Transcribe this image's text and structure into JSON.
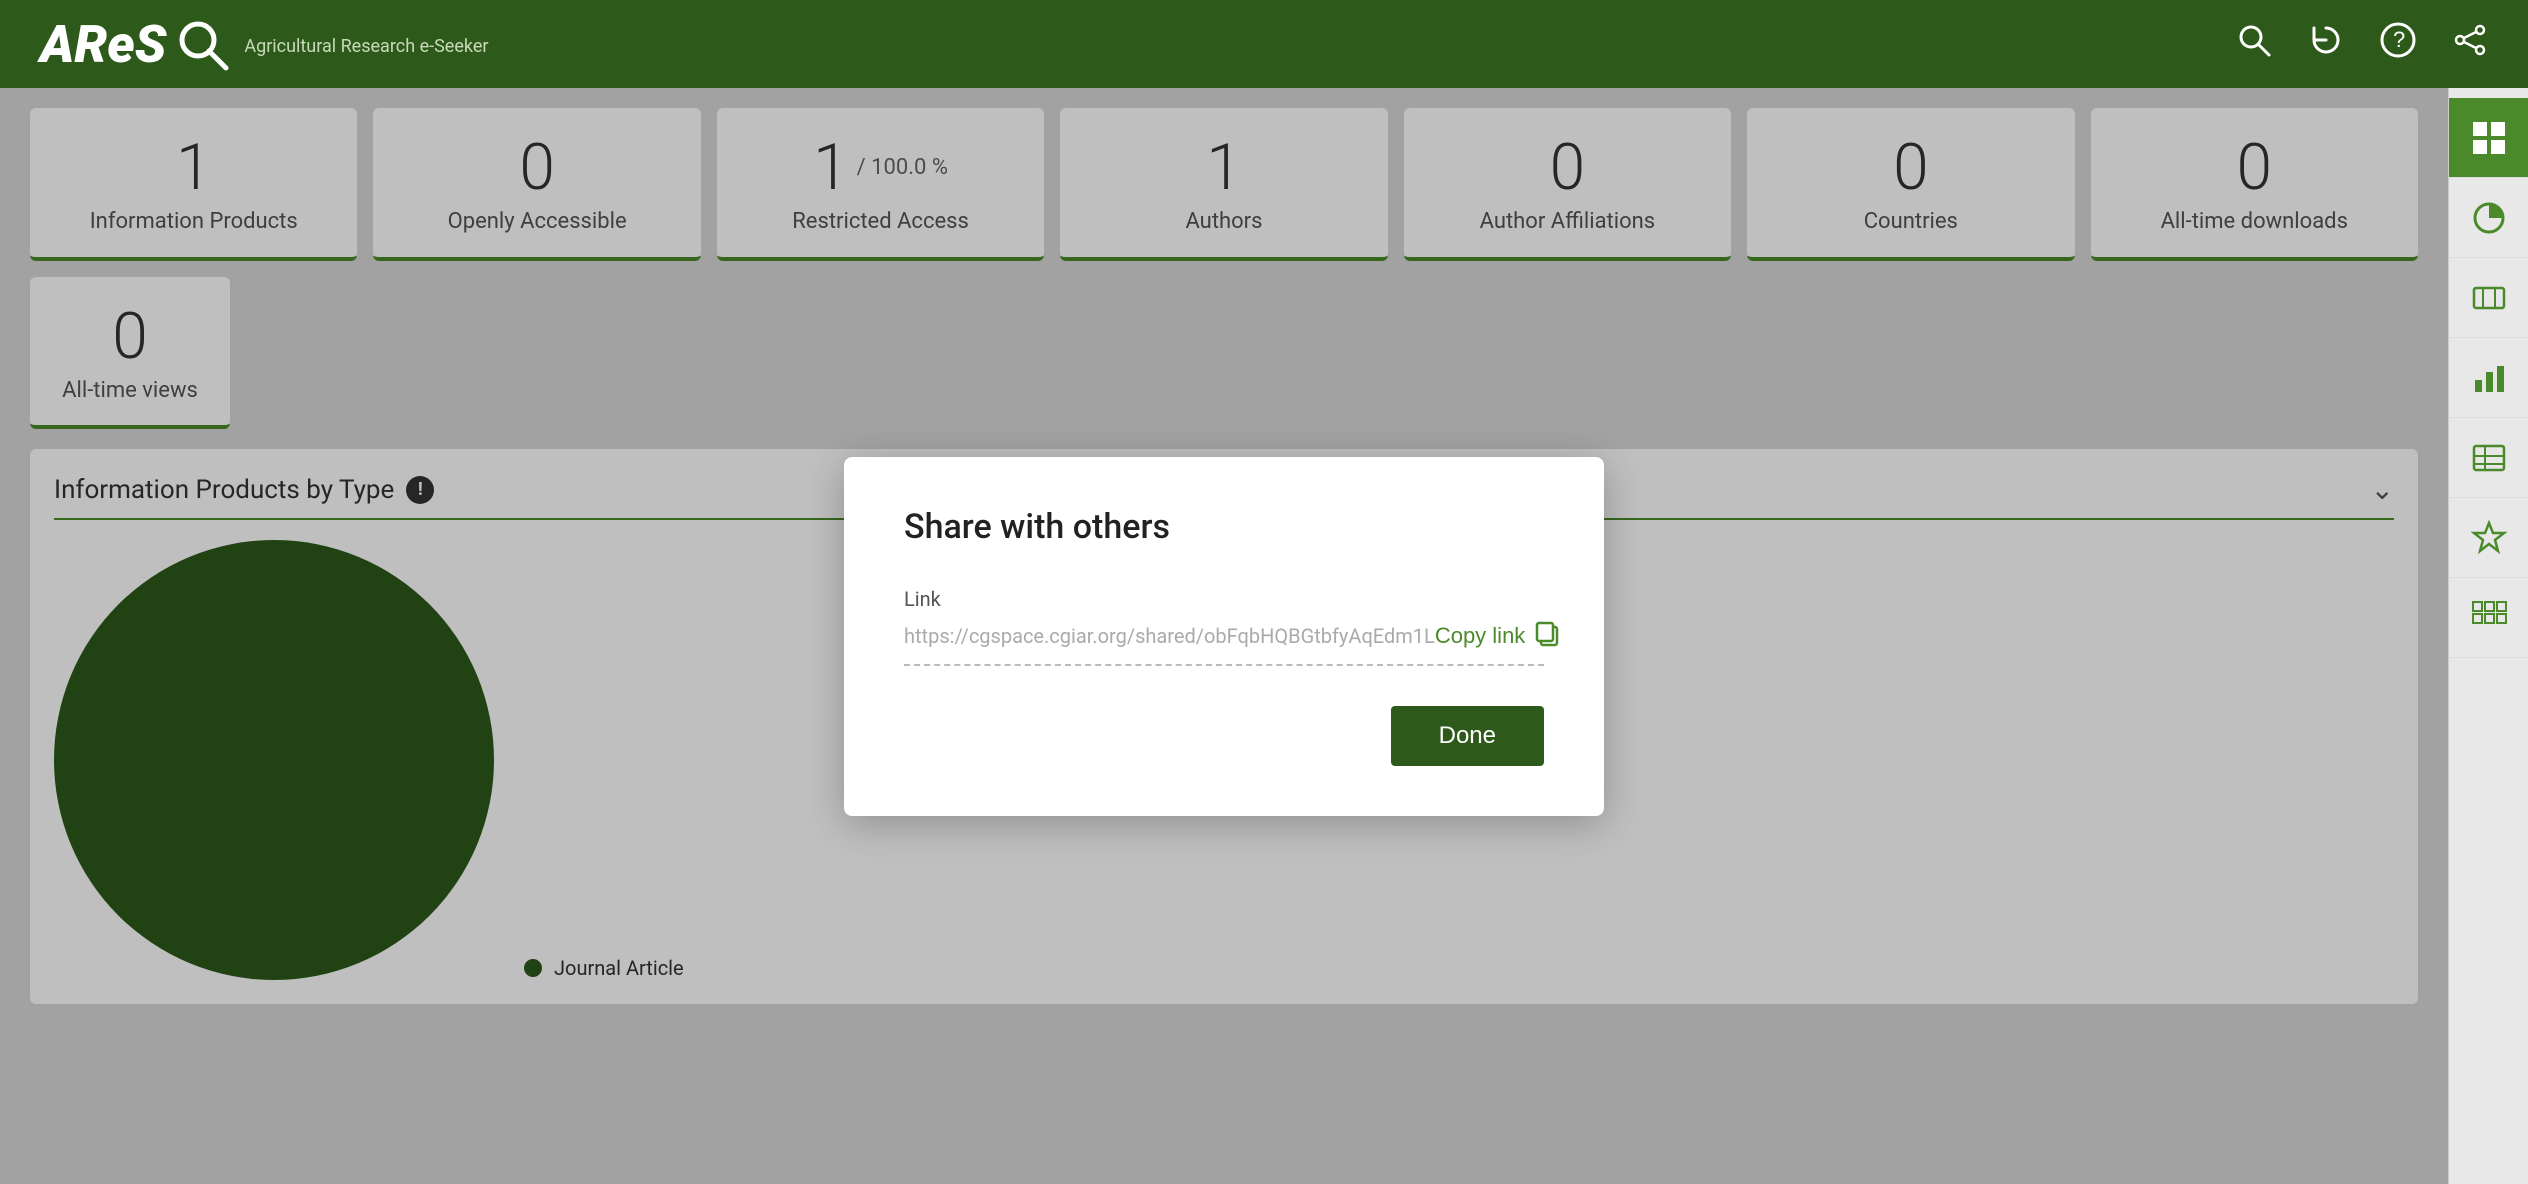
{
  "header": {
    "app_name": "AReS",
    "app_subtitle": "Agricultural Research e-Seeker",
    "icons": [
      "search",
      "refresh",
      "help",
      "share"
    ]
  },
  "stats": {
    "row1": [
      {
        "number": "1",
        "label": "Information Products",
        "suffix": ""
      },
      {
        "number": "0",
        "label": "Openly Accessible",
        "suffix": ""
      },
      {
        "number": "1",
        "label": "Restricted Access",
        "suffix": "/ 100.0 %"
      },
      {
        "number": "1",
        "label": "Authors",
        "suffix": ""
      },
      {
        "number": "0",
        "label": "Author Affiliations",
        "suffix": ""
      },
      {
        "number": "0",
        "label": "Countries",
        "suffix": ""
      },
      {
        "number": "0",
        "label": "All-time downloads",
        "suffix": ""
      }
    ],
    "row2": [
      {
        "number": "0",
        "label": "All-time views"
      }
    ]
  },
  "chart": {
    "title": "Information Products by Type",
    "legend": [
      {
        "label": "Journal Article",
        "color": "#2d5a1b"
      }
    ]
  },
  "modal": {
    "title": "Share with others",
    "link_label": "Link",
    "link_value": "https://cgspace.cgiar.org/shared/obFqbHQBGtbfyAqEdm1L",
    "copy_link_label": "Copy link",
    "done_label": "Done"
  },
  "sidebar": {
    "icons": [
      {
        "name": "grid-icon",
        "label": "Grid",
        "active": true
      },
      {
        "name": "pie-chart-icon",
        "label": "Pie Chart",
        "active": false
      },
      {
        "name": "map-icon",
        "label": "Map",
        "active": false
      },
      {
        "name": "bar-chart-icon",
        "label": "Bar Chart",
        "active": false
      },
      {
        "name": "table-icon",
        "label": "Table",
        "active": false
      },
      {
        "name": "star-icon",
        "label": "Favorites",
        "active": false
      },
      {
        "name": "grid2-icon",
        "label": "Grid 2",
        "active": false
      }
    ]
  }
}
